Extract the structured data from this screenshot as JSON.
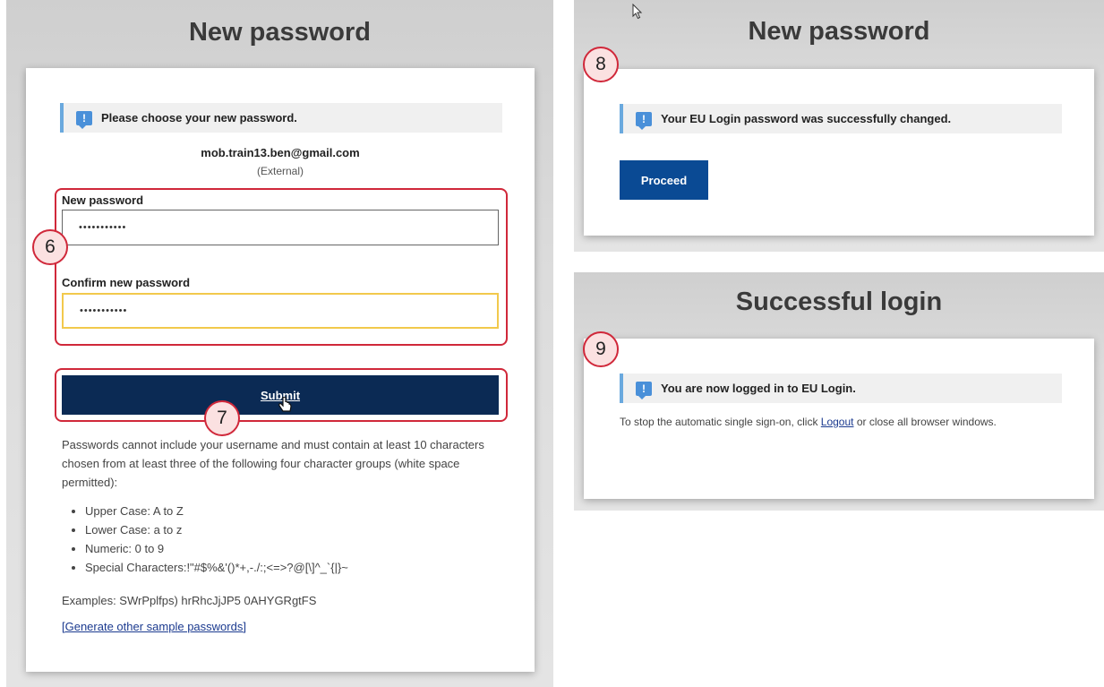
{
  "left_panel": {
    "title": "New password",
    "info": "Please choose your new password.",
    "email": "mob.train13.ben@gmail.com",
    "account_type": "(External)",
    "new_password_label": "New password",
    "new_password_value": "•••••••••••",
    "confirm_password_label": "Confirm new password",
    "confirm_password_value": "•••••••••••",
    "submit_label": "Submit",
    "rules_intro": "Passwords cannot include your username and must contain at least 10 characters chosen from at least three of the following four character groups (white space permitted):",
    "rules": [
      "Upper Case: A to Z",
      "Lower Case: a to z",
      "Numeric: 0 to 9",
      "Special Characters:!\"#$%&'()*+,-./:;<=>?@[\\]^_`{|}~"
    ],
    "examples": "Examples: SWrPplfps) hrRhcJjJP5 0AHYGRgtFS",
    "generate_link": "[Generate other sample passwords]"
  },
  "steps": {
    "s6": "6",
    "s7": "7",
    "s8": "8",
    "s9": "9"
  },
  "top_right_panel": {
    "title": "New password",
    "info": "Your EU Login password was successfully changed.",
    "proceed_label": "Proceed"
  },
  "bottom_right_panel": {
    "title": "Successful login",
    "info": "You are now logged in to EU Login.",
    "text_before": "To stop the automatic single sign-on, click ",
    "logout_link": "Logout",
    "text_after": " or close all browser windows."
  },
  "icons": {
    "info_icon": "!",
    "cursor": "pointer-hand-icon"
  },
  "colors": {
    "submit_bg": "#0b2a54",
    "proceed_bg": "#0a4a94",
    "highlight": "#d0283a",
    "info_accent": "#6aa9de",
    "confirm_border": "#f2c94c"
  }
}
